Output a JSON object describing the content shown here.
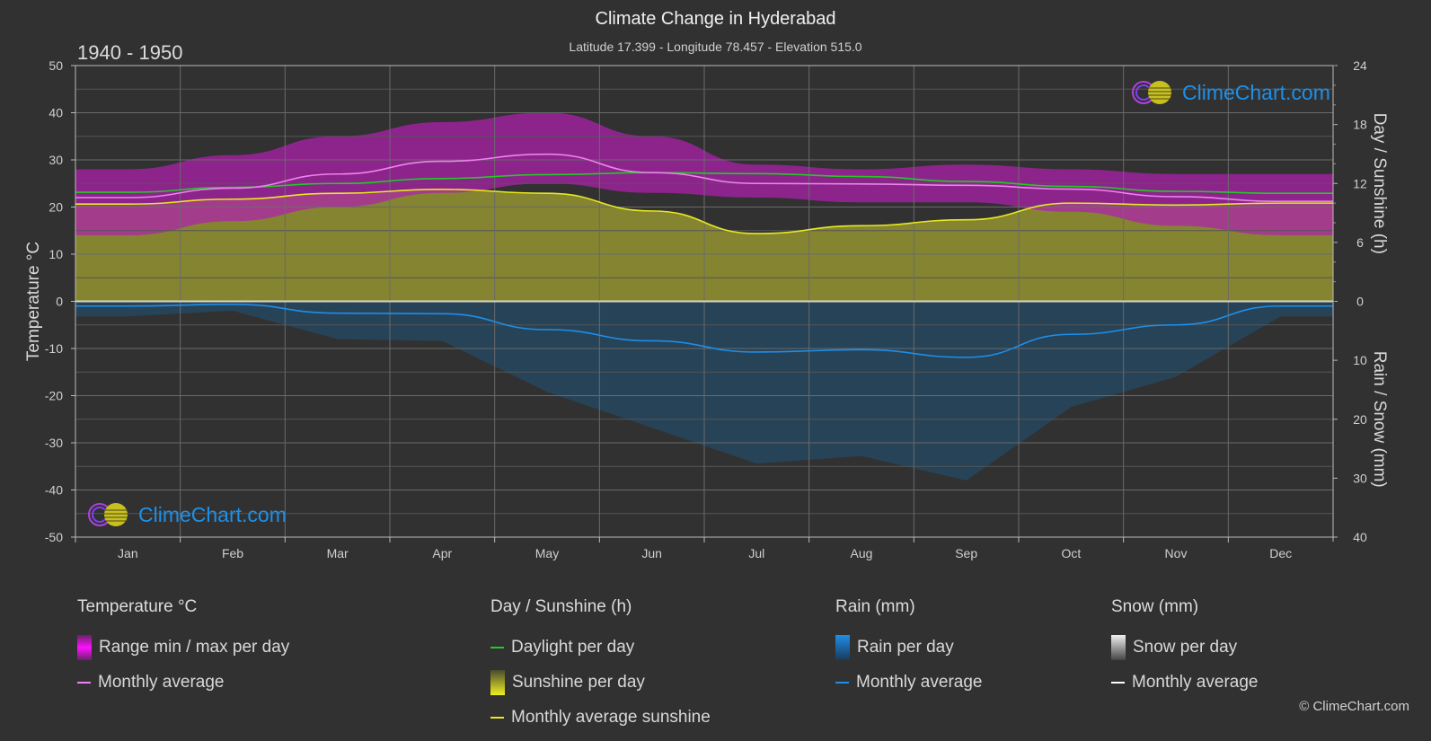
{
  "header": {
    "title": "Climate Change in Hyderabad",
    "subtitle": "Latitude 17.399 - Longitude 78.457 - Elevation 515.0",
    "period": "1940 - 1950"
  },
  "logo": {
    "text": "ClimeChart.com"
  },
  "copyright": "© ClimeChart.com",
  "legend": {
    "temperature": {
      "title": "Temperature °C",
      "items": [
        "Range min / max per day",
        "Monthly average"
      ]
    },
    "sunshine": {
      "title": "Day / Sunshine (h)",
      "items": [
        "Daylight per day",
        "Sunshine per day",
        "Monthly average sunshine"
      ]
    },
    "rain": {
      "title": "Rain (mm)",
      "items": [
        "Rain per day",
        "Monthly average"
      ]
    },
    "snow": {
      "title": "Snow (mm)",
      "items": [
        "Snow per day",
        "Monthly average"
      ]
    }
  },
  "colors": {
    "background": "#313131",
    "temp_range": "#b020b0",
    "temp_avg": "#ee82ee",
    "daylight": "#22cc22",
    "sunshine_fill": "#8a8a32",
    "sunshine_avg": "#e8e820",
    "rain_fill": "#1d5a8a",
    "rain_avg": "#1e8ee8",
    "snow_avg": "#ffffff"
  },
  "chart_data": {
    "type": "area",
    "title": "Climate Change in Hyderabad",
    "categories": [
      "Jan",
      "Feb",
      "Mar",
      "Apr",
      "May",
      "Jun",
      "Jul",
      "Aug",
      "Sep",
      "Oct",
      "Nov",
      "Dec"
    ],
    "axes": {
      "left": {
        "label": "Temperature °C",
        "range": [
          -50,
          50
        ],
        "ticks": [
          50,
          40,
          30,
          20,
          10,
          0,
          -10,
          -20,
          -30,
          -40,
          -50
        ]
      },
      "right_top": {
        "label": "Day / Sunshine (h)",
        "range": [
          0,
          24
        ],
        "ticks": [
          24,
          18,
          12,
          6,
          0
        ]
      },
      "right_bottom": {
        "label": "Rain / Snow (mm)",
        "range": [
          0,
          40
        ],
        "ticks": [
          0,
          10,
          20,
          30,
          40
        ]
      }
    },
    "grid": true,
    "series": [
      {
        "name": "Temperature monthly average (°C)",
        "axis": "left",
        "values": [
          22.0,
          24.0,
          27.0,
          29.7,
          31.2,
          27.3,
          25.0,
          24.9,
          24.6,
          23.8,
          22.2,
          21.2
        ]
      },
      {
        "name": "Temperature daily max (°C, approx)",
        "axis": "left",
        "values": [
          28,
          31,
          35,
          38,
          40,
          35,
          29,
          28,
          29,
          28,
          27,
          27
        ]
      },
      {
        "name": "Temperature daily min (°C, approx)",
        "axis": "left",
        "values": [
          14,
          17,
          20,
          23,
          25,
          23,
          22,
          21,
          21,
          19,
          16,
          14
        ]
      },
      {
        "name": "Daylight per day (h)",
        "axis": "right_top",
        "values": [
          11.1,
          11.6,
          12.0,
          12.5,
          12.9,
          13.1,
          13.0,
          12.7,
          12.2,
          11.7,
          11.2,
          11.0
        ]
      },
      {
        "name": "Monthly average sunshine (h)",
        "axis": "right_top",
        "values": [
          9.9,
          10.4,
          11.0,
          11.4,
          11.0,
          9.2,
          6.9,
          7.7,
          8.3,
          10.0,
          9.8,
          10.0
        ]
      },
      {
        "name": "Rain monthly average (mm)",
        "axis": "right_bottom",
        "values": [
          0.8,
          0.5,
          2.0,
          2.1,
          4.8,
          6.7,
          8.6,
          8.2,
          9.5,
          5.6,
          4.0,
          0.8
        ]
      },
      {
        "name": "Snow monthly average (mm)",
        "axis": "right_bottom",
        "values": [
          0,
          0,
          0,
          0,
          0,
          0,
          0,
          0,
          0,
          0,
          0,
          0
        ]
      }
    ]
  }
}
